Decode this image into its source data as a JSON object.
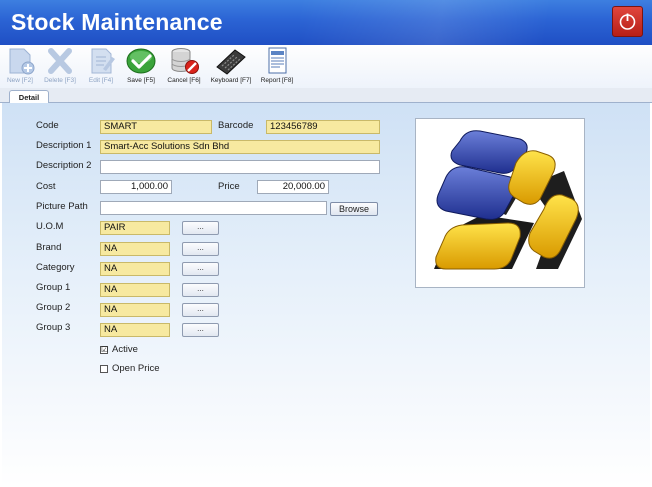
{
  "window": {
    "title": "Stock Maintenance",
    "close_icon": "power-icon"
  },
  "toolbar": {
    "new": {
      "label": "New [F2]",
      "icon": "new-document-icon",
      "enabled": false
    },
    "delete": {
      "label": "Delete [F3]",
      "icon": "delete-x-icon",
      "enabled": false
    },
    "edit": {
      "label": "Edit [F4]",
      "icon": "edit-document-icon",
      "enabled": false
    },
    "save": {
      "label": "Save [F5]",
      "icon": "checkmark-icon",
      "enabled": true
    },
    "cancel": {
      "label": "Cancel [F6]",
      "icon": "cancel-database-icon",
      "enabled": true
    },
    "keyboard": {
      "label": "Keyboard [F7]",
      "icon": "keyboard-icon",
      "enabled": true
    },
    "report": {
      "label": "Report [F8]",
      "icon": "report-icon",
      "enabled": true
    }
  },
  "tabs": {
    "detail": "Detail"
  },
  "form": {
    "code": {
      "label": "Code",
      "value": "SMART"
    },
    "barcode": {
      "label": "Barcode",
      "value": "123456789"
    },
    "description1": {
      "label": "Description 1",
      "value": "Smart-Acc Solutions Sdn Bhd"
    },
    "description2": {
      "label": "Description 2",
      "value": ""
    },
    "cost": {
      "label": "Cost",
      "value": "1,000.00"
    },
    "price": {
      "label": "Price",
      "value": "20,000.00"
    },
    "picture_path": {
      "label": "Picture Path",
      "value": "",
      "browse_label": "Browse"
    },
    "uom": {
      "label": "U.O.M",
      "value": "PAIR"
    },
    "brand": {
      "label": "Brand",
      "value": "NA"
    },
    "category": {
      "label": "Category",
      "value": "NA"
    },
    "group1": {
      "label": "Group 1",
      "value": "NA"
    },
    "group2": {
      "label": "Group 2",
      "value": "NA"
    },
    "group3": {
      "label": "Group 3",
      "value": "NA"
    },
    "lookup_label": "...",
    "active": {
      "label": "Active",
      "checked": true,
      "mark": "☑"
    },
    "open_price": {
      "label": "Open Price",
      "checked": false,
      "mark": ""
    }
  },
  "colors": {
    "titlebar": "#2b63d4",
    "field_yellow": "#f7e9a0",
    "logo_blue": "#2b3fa8",
    "logo_yellow": "#f5b800"
  }
}
